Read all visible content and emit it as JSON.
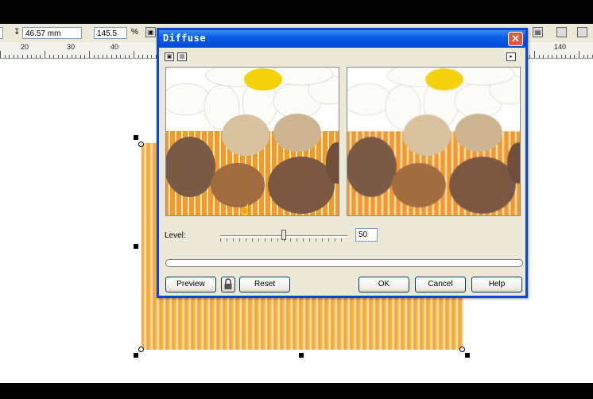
{
  "property_bar": {
    "height_value": "46.57 mm",
    "scale_value": "145.5",
    "scale_unit": "%"
  },
  "ruler": {
    "labels": [
      "20",
      "30",
      "40",
      "140"
    ]
  },
  "dialog": {
    "title": "Diffuse",
    "close_glyph": "✕",
    "level_label": "Level:",
    "level_value": "50",
    "level_fraction": 0.5,
    "buttons": {
      "preview": "Preview",
      "reset": "Reset",
      "ok": "OK",
      "cancel": "Cancel",
      "help": "Help"
    },
    "icons": [
      "zoom-in-icon",
      "zoom-out-icon",
      "expand-arrow-icon",
      "lock-icon",
      "hand-cursor-icon"
    ]
  },
  "colors": {
    "titlebar": "#0a5ee8",
    "dialog_bg": "#ece9d8",
    "bamboo": "#f6a33a",
    "close": "#e2583a"
  }
}
